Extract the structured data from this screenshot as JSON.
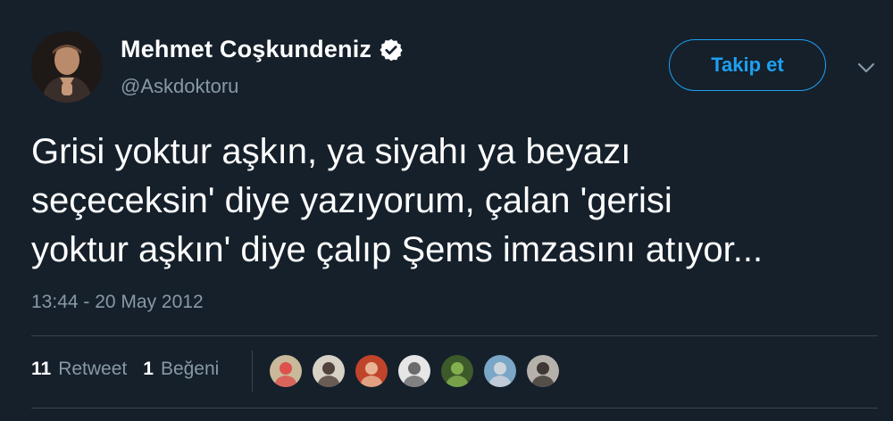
{
  "author": {
    "name": "Mehmet Coşkundeniz",
    "handle": "@Askdoktoru",
    "verified_color": "#ffffff"
  },
  "follow_button": {
    "label": "Takip et"
  },
  "tweet": {
    "text": "Grisi yoktur aşkın, ya siyahı ya beyazı\nseçeceksin' diye yazıyorum, çalan 'gerisi\nyoktur aşkın' diye çalıp Şems imzasını atıyor...",
    "timestamp": "13:44 - 20 May 2012"
  },
  "stats": {
    "retweets_count": "11",
    "retweets_label": "Retweet",
    "likes_count": "1",
    "likes_label": "Beğeni"
  },
  "liker_avatars": [
    {
      "icon": "avatar-1",
      "bg": "#c9b99a",
      "fg": "#e04040"
    },
    {
      "icon": "avatar-2",
      "bg": "#d8d2c6",
      "fg": "#3a2a24"
    },
    {
      "icon": "avatar-3",
      "bg": "#c0442a",
      "fg": "#f0c8a8"
    },
    {
      "icon": "avatar-4",
      "bg": "#e6e6e6",
      "fg": "#555555"
    },
    {
      "icon": "avatar-5",
      "bg": "#3d5a2a",
      "fg": "#8fbf55"
    },
    {
      "icon": "avatar-6",
      "bg": "#7aa6c8",
      "fg": "#dddddd"
    },
    {
      "icon": "avatar-7",
      "bg": "#b7b1ab",
      "fg": "#2a2320"
    }
  ],
  "colors": {
    "background": "#15202b",
    "accent": "#1da1f2",
    "secondary_text": "#8899a6",
    "divider": "#38444d"
  }
}
